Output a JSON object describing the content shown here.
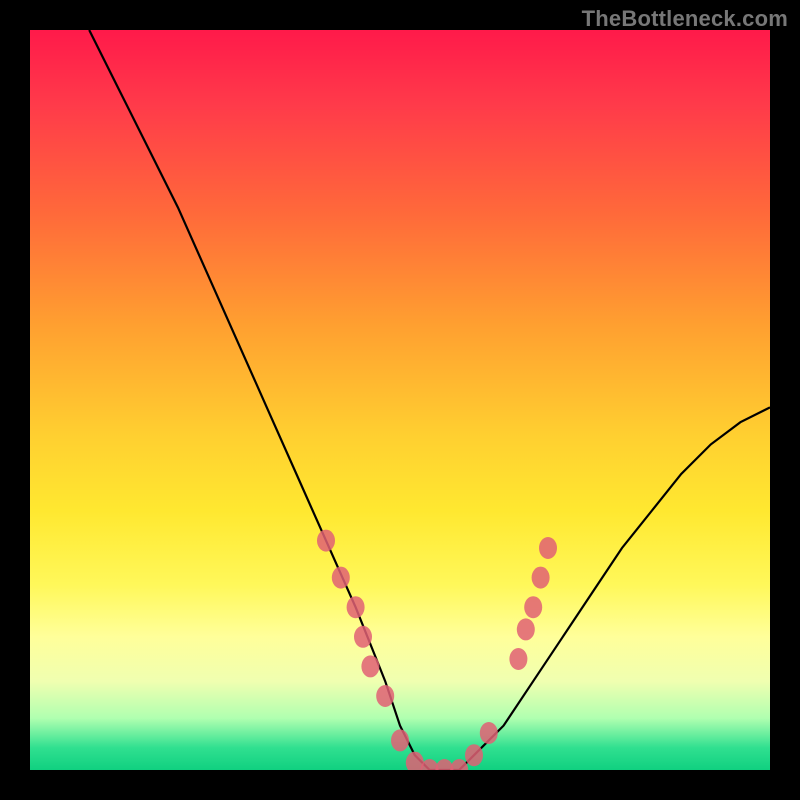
{
  "watermark": "TheBottleneck.com",
  "chart_data": {
    "type": "line",
    "title": "",
    "xlabel": "",
    "ylabel": "",
    "xlim": [
      0,
      100
    ],
    "ylim": [
      0,
      100
    ],
    "grid": false,
    "legend": false,
    "series": [
      {
        "name": "bottleneck-curve",
        "x": [
          8,
          12,
          16,
          20,
          24,
          28,
          32,
          36,
          40,
          44,
          48,
          50,
          52,
          54,
          56,
          58,
          60,
          64,
          68,
          72,
          76,
          80,
          84,
          88,
          92,
          96,
          100
        ],
        "values": [
          100,
          92,
          84,
          76,
          67,
          58,
          49,
          40,
          31,
          22,
          12,
          6,
          2,
          0,
          0,
          0,
          2,
          6,
          12,
          18,
          24,
          30,
          35,
          40,
          44,
          47,
          49
        ]
      }
    ],
    "markers": [
      {
        "x": 40,
        "y": 31
      },
      {
        "x": 42,
        "y": 26
      },
      {
        "x": 44,
        "y": 22
      },
      {
        "x": 45,
        "y": 18
      },
      {
        "x": 46,
        "y": 14
      },
      {
        "x": 48,
        "y": 10
      },
      {
        "x": 50,
        "y": 4
      },
      {
        "x": 52,
        "y": 1
      },
      {
        "x": 54,
        "y": 0
      },
      {
        "x": 56,
        "y": 0
      },
      {
        "x": 58,
        "y": 0
      },
      {
        "x": 60,
        "y": 2
      },
      {
        "x": 62,
        "y": 5
      },
      {
        "x": 66,
        "y": 15
      },
      {
        "x": 67,
        "y": 19
      },
      {
        "x": 68,
        "y": 22
      },
      {
        "x": 69,
        "y": 26
      },
      {
        "x": 70,
        "y": 30
      }
    ],
    "background_gradient": {
      "top": "#ff1a4a",
      "mid": "#ffe040",
      "bottom": "#10d080"
    }
  }
}
